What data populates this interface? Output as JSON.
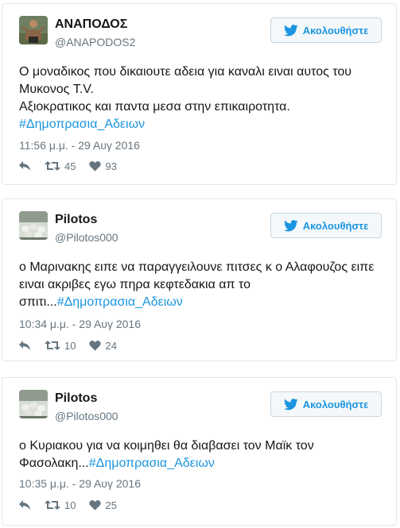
{
  "colors": {
    "accent": "#1b95e0",
    "muted": "#66757f",
    "border": "#e1e8ed",
    "text": "#14171a"
  },
  "tweets": [
    {
      "name": "ΑΝΑΠΟΔΟΣ",
      "handle": "@ANAPODOS2",
      "follow_label": "Ακολουθήστε",
      "text_lines": [
        "Ο μοναδικος που δικαιουτε αδεια για καναλι ειναι αυτος του",
        "Μυκονος T.V.",
        "Αξιοκρατικος και παντα μεσα στην επικαιροτητα."
      ],
      "text_tail": "",
      "hashtag": "#Δημοπρασια_Αδειων",
      "timestamp": "11:56 μ.μ. - 29 Αυγ 2016",
      "retweets": "45",
      "likes": "93",
      "icons": {
        "reply": "reply-icon",
        "retweet": "retweet-icon",
        "like": "heart-icon",
        "follow": "twitter-bird-icon"
      }
    },
    {
      "name": "Pilotos",
      "handle": "@Pilotos000",
      "follow_label": "Ακολουθήστε",
      "text_lines": [
        "ο Μαρινακης ειπε να παραγγειλουνε πιτσες κ ο Αλαφουζος ειπε",
        "ειναι ακριβες εγω πηρα κεφτεδακια απ το"
      ],
      "text_tail": "σπιτι...",
      "hashtag": "#Δημοπρασια_Αδειων",
      "timestamp": "10:34 μ.μ. - 29 Αυγ 2016",
      "retweets": "10",
      "likes": "24",
      "icons": {
        "reply": "reply-icon",
        "retweet": "retweet-icon",
        "like": "heart-icon",
        "follow": "twitter-bird-icon"
      }
    },
    {
      "name": "Pilotos",
      "handle": "@Pilotos000",
      "follow_label": "Ακολουθήστε",
      "text_lines": [
        "ο Κυριακου για να κοιμηθει θα διαβασει τον Μαϊκ τον"
      ],
      "text_tail": "Φασολακη...",
      "hashtag": "#Δημοπρασια_Αδειων",
      "timestamp": "10:35 μ.μ. - 29 Αυγ 2016",
      "retweets": "10",
      "likes": "25",
      "icons": {
        "reply": "reply-icon",
        "retweet": "retweet-icon",
        "like": "heart-icon",
        "follow": "twitter-bird-icon"
      }
    }
  ]
}
